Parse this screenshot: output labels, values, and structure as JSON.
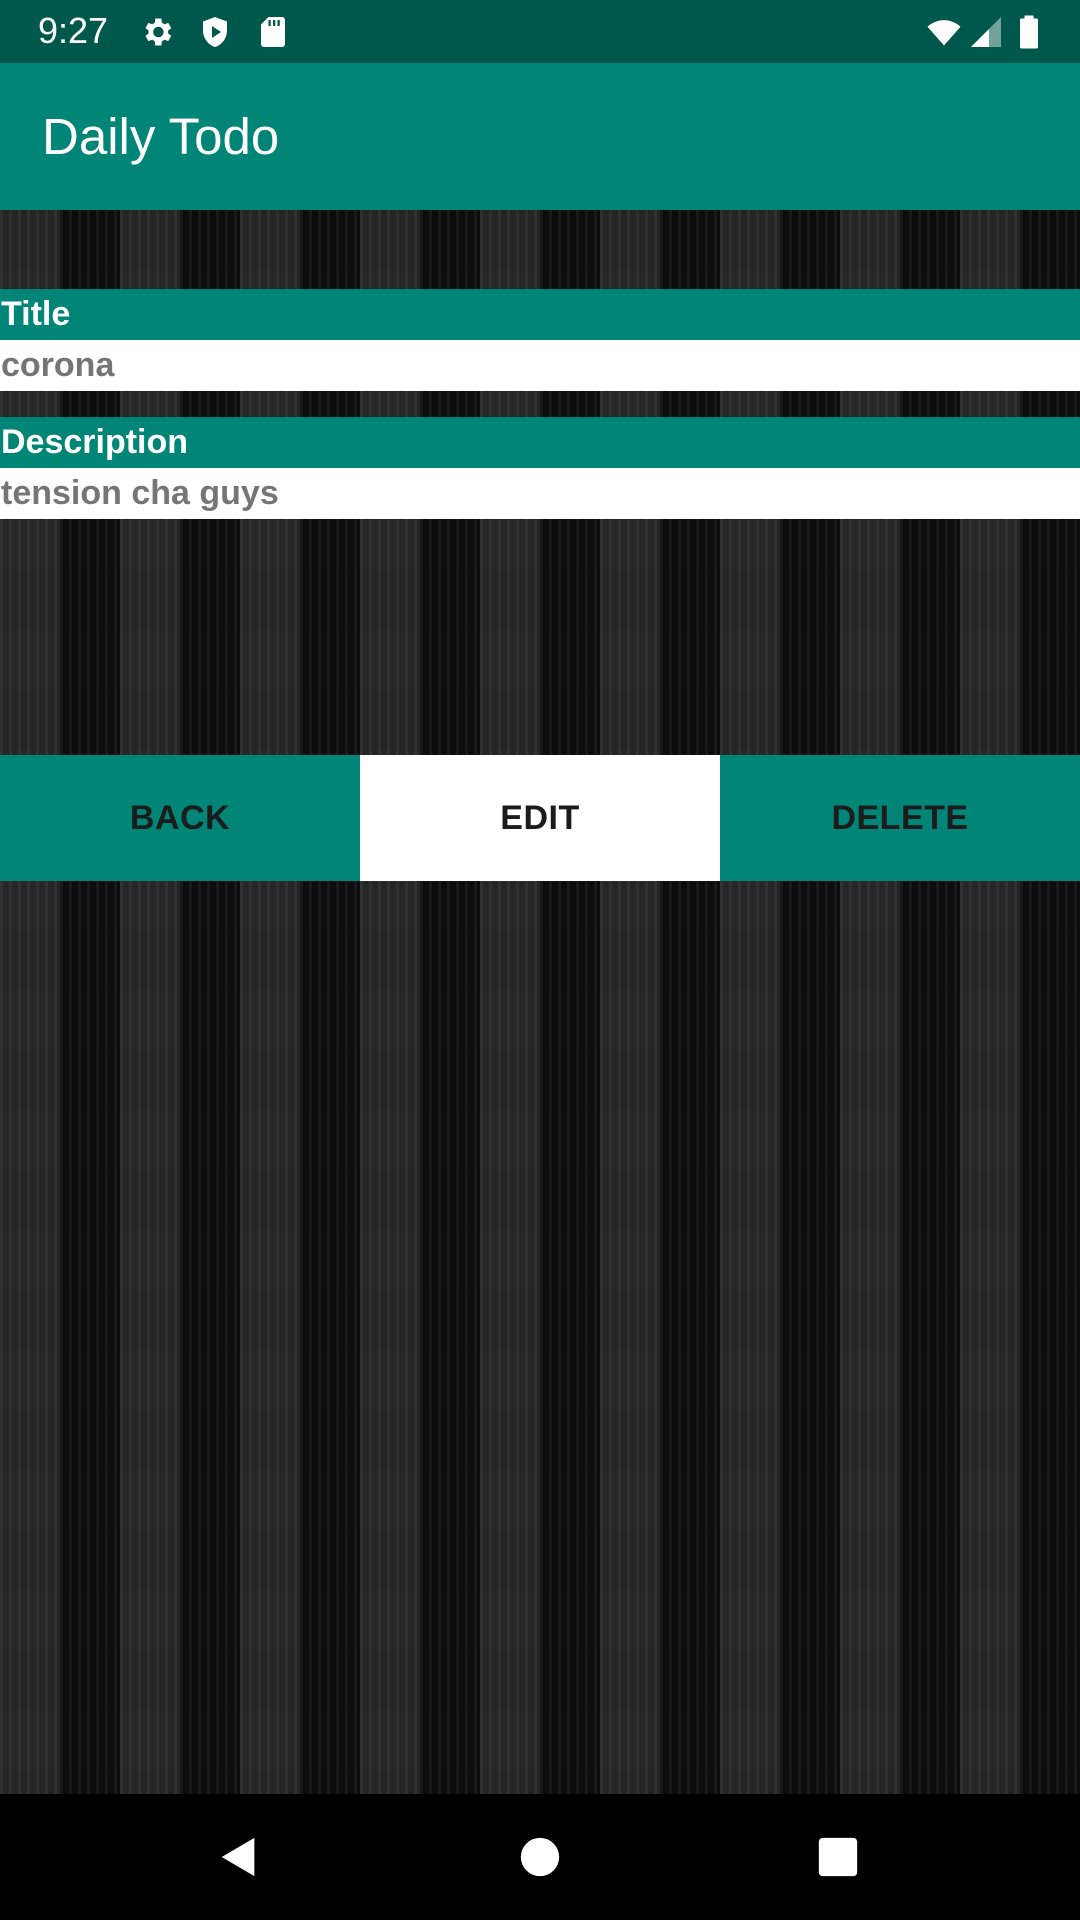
{
  "status_bar": {
    "time": "9:27",
    "icons_left": [
      "gear-icon",
      "shield-icon",
      "sd-card-icon"
    ],
    "icons_right": [
      "wifi-icon",
      "cell-signal-icon",
      "battery-icon"
    ]
  },
  "app_bar": {
    "title": "Daily Todo"
  },
  "form": {
    "title_label": "Title",
    "title_value": "corona",
    "description_label": "Description",
    "description_value": "tension cha guys"
  },
  "buttons": {
    "back": "BACK",
    "edit": "EDIT",
    "delete": "DELETE"
  },
  "nav_bar": {
    "icons": [
      "back-triangle-icon",
      "home-circle-icon",
      "recents-square-icon"
    ]
  },
  "colors": {
    "primary": "#008577",
    "primary_dark": "#00574b",
    "value_text": "#757575"
  }
}
